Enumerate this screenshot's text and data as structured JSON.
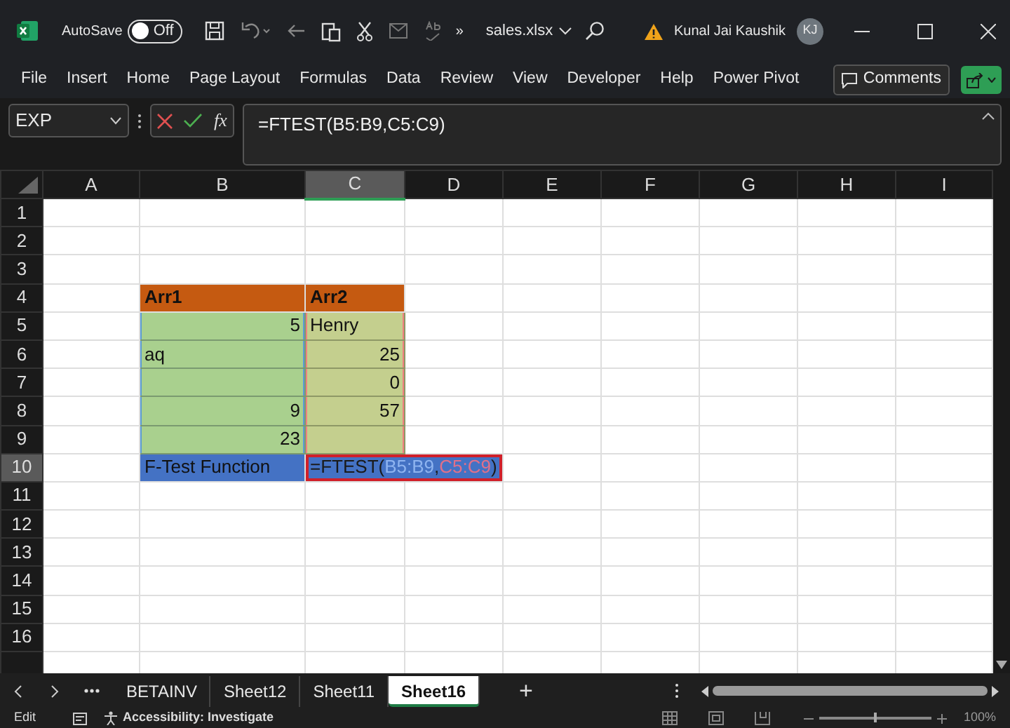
{
  "window": {
    "autosave_label": "AutoSave",
    "autosave": {
      "on": false,
      "label": "Off"
    },
    "overflow": "»",
    "file_name": "sales.xlsx",
    "user_name": "Kunal Jai Kaushik",
    "user_initials": "KJ"
  },
  "ribbon_tabs": [
    "File",
    "Insert",
    "Home",
    "Page Layout",
    "Formulas",
    "Data",
    "Review",
    "View",
    "Developer",
    "Help",
    "Power Pivot"
  ],
  "comments_button": "Comments",
  "formula_bar": {
    "name_box": "EXP",
    "fx": "fx",
    "formula": "=FTEST(B5:B9,C5:C9)"
  },
  "columns": [
    {
      "label": "A",
      "selected": false
    },
    {
      "label": "B",
      "selected": false
    },
    {
      "label": "C",
      "selected": true
    },
    {
      "label": "D",
      "selected": false
    },
    {
      "label": "E",
      "selected": false
    },
    {
      "label": "F",
      "selected": false
    },
    {
      "label": "G",
      "selected": false
    },
    {
      "label": "H",
      "selected": false
    },
    {
      "label": "I",
      "selected": false
    }
  ],
  "rows": [
    {
      "label": "1",
      "selected": false,
      "cells": {}
    },
    {
      "label": "2",
      "selected": false,
      "cells": {}
    },
    {
      "label": "3",
      "selected": false,
      "cells": {}
    },
    {
      "label": "4",
      "selected": false,
      "cells": {
        "B": {
          "kind": "header",
          "text": "Arr1"
        },
        "C": {
          "kind": "header",
          "text": "Arr2"
        }
      }
    },
    {
      "label": "5",
      "selected": false,
      "cells": {
        "B": {
          "kind": "range-first",
          "text": "5",
          "numeric": true
        },
        "C": {
          "kind": "range-second",
          "text": "Henry",
          "numeric": false
        }
      }
    },
    {
      "label": "6",
      "selected": false,
      "cells": {
        "B": {
          "kind": "range-first",
          "text": "aq",
          "numeric": false
        },
        "C": {
          "kind": "range-second",
          "text": "25",
          "numeric": true
        }
      }
    },
    {
      "label": "7",
      "selected": false,
      "cells": {
        "B": {
          "kind": "range-first"
        },
        "C": {
          "kind": "range-second",
          "text": "0",
          "numeric": true
        }
      }
    },
    {
      "label": "8",
      "selected": false,
      "cells": {
        "B": {
          "kind": "range-first",
          "text": "9",
          "numeric": true
        },
        "C": {
          "kind": "range-second",
          "text": "57",
          "numeric": true
        }
      }
    },
    {
      "label": "9",
      "selected": false,
      "cells": {
        "B": {
          "kind": "range-first",
          "text": "23",
          "numeric": true
        },
        "C": {
          "kind": "range-second"
        }
      }
    },
    {
      "label": "10",
      "selected": true,
      "cells": {
        "B": {
          "kind": "label",
          "text": "F-Test Function",
          "numeric": false
        },
        "C": {
          "kind": "formula",
          "spill": true,
          "highlighted": true,
          "formula": {
            "prefix": "=FTEST(",
            "first_range": "B5:B9",
            "separator": ",",
            "second_range": "C5:C9",
            "suffix": ")"
          }
        }
      }
    },
    {
      "label": "11",
      "selected": false,
      "cells": {}
    },
    {
      "label": "12",
      "selected": false,
      "cells": {}
    },
    {
      "label": "13",
      "selected": false,
      "cells": {}
    },
    {
      "label": "14",
      "selected": false,
      "cells": {}
    },
    {
      "label": "15",
      "selected": false,
      "cells": {}
    },
    {
      "label": "16",
      "selected": false,
      "cells": {}
    }
  ],
  "sheet_tabs": [
    {
      "label": "BETAINV",
      "selected": false
    },
    {
      "label": "Sheet12",
      "selected": false
    },
    {
      "label": "Sheet11",
      "selected": false
    },
    {
      "label": "Sheet16",
      "selected": true
    }
  ],
  "add_sheet": "+",
  "status_bar": {
    "mode": "Edit",
    "accessibility": "Accessibility: Investigate",
    "zoom": "100%",
    "zoom_slider": {
      "level": 0.5
    }
  }
}
